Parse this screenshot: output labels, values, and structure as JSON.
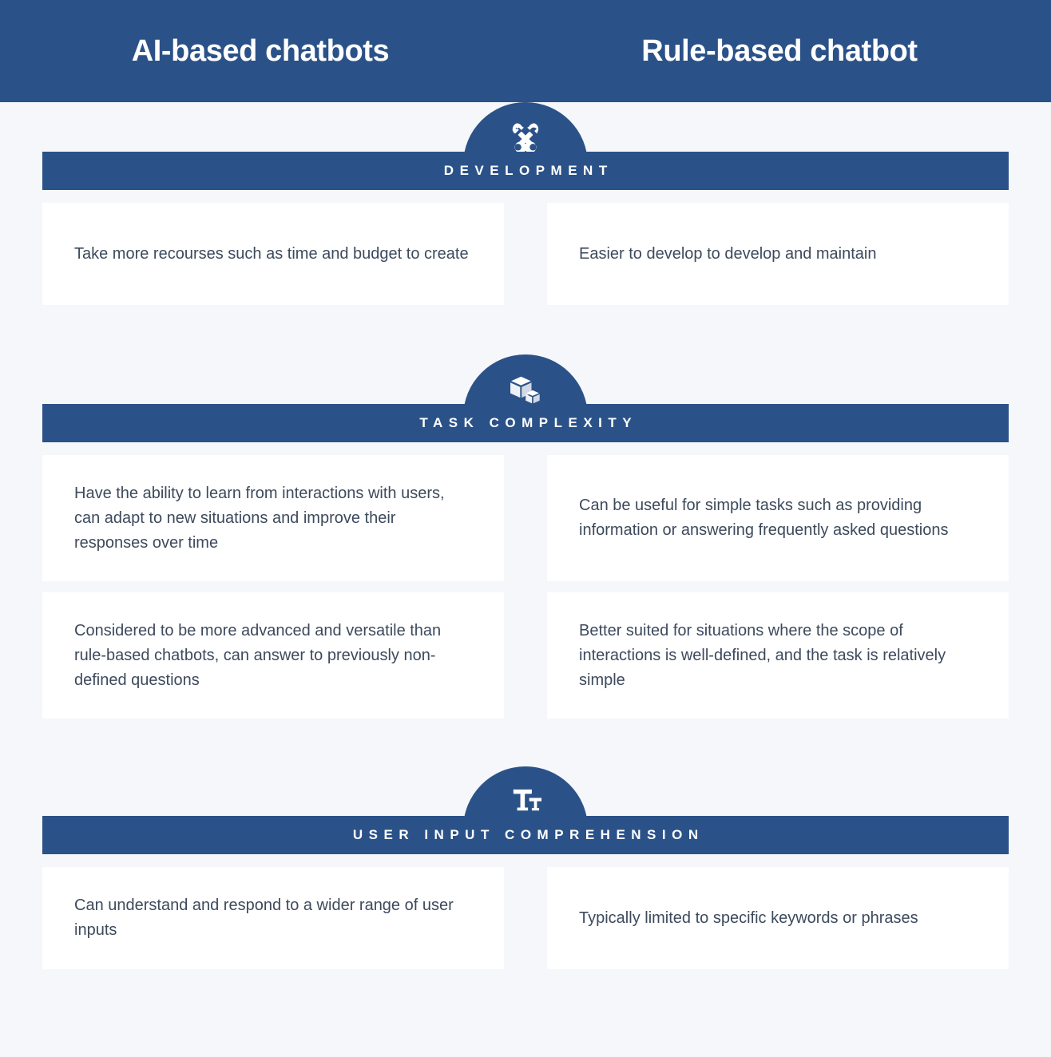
{
  "colors": {
    "brand_blue": "#2b5288",
    "page_background": "#f5f7fa",
    "card_background": "#ffffff",
    "body_text": "#3d4a5c",
    "header_text": "#ffffff"
  },
  "header": {
    "left_title": "AI-based chatbots",
    "right_title": "Rule-based chatbot"
  },
  "sections": [
    {
      "id": "development",
      "label": "DEVELOPMENT",
      "icon": "crossed-wrenches-icon",
      "rows": [
        {
          "left": "Take more recourses such as time and budget to create",
          "right": "Easier to develop to develop and maintain"
        }
      ]
    },
    {
      "id": "task-complexity",
      "label": "TASK COMPLEXITY",
      "icon": "boxes-icon",
      "rows": [
        {
          "left": "Have the ability to learn from interactions with users, can adapt to new situations and improve their responses over time",
          "right": "Can be useful for simple tasks such as providing information or answering frequently asked questions"
        },
        {
          "left": "Considered to be more advanced and versatile than rule-based chatbots, can answer to previously non-defined questions",
          "right": "Better suited for situations where the scope of interactions is well-defined, and the task is relatively simple"
        }
      ]
    },
    {
      "id": "user-input-comprehension",
      "label": "USER INPUT COMPREHENSION",
      "icon": "text-size-icon",
      "rows": [
        {
          "left": "Can understand and respond to a wider range of user inputs",
          "right": "Typically limited to specific keywords or phrases"
        }
      ]
    }
  ]
}
